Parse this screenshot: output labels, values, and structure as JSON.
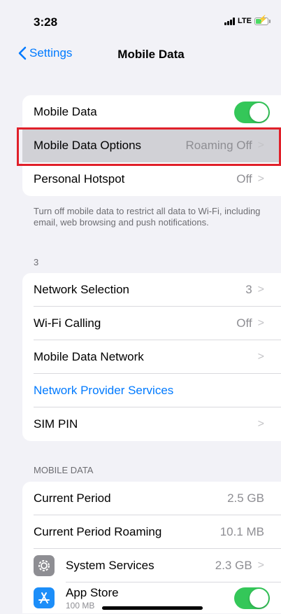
{
  "status_bar": {
    "time": "3:28",
    "network": "LTE"
  },
  "nav": {
    "back_label": "Settings",
    "title": "Mobile Data"
  },
  "group1": {
    "mobile_data": {
      "label": "Mobile Data",
      "toggle_on": true
    },
    "mobile_data_options": {
      "label": "Mobile Data Options",
      "value": "Roaming Off"
    },
    "personal_hotspot": {
      "label": "Personal Hotspot",
      "value": "Off"
    }
  },
  "group1_footer": "Turn off mobile data to restrict all data to Wi-Fi, including email, web browsing and push notifications.",
  "carrier_header": "3",
  "group2": {
    "network_selection": {
      "label": "Network Selection",
      "value": "3"
    },
    "wifi_calling": {
      "label": "Wi-Fi Calling",
      "value": "Off"
    },
    "mobile_data_network": {
      "label": "Mobile Data Network"
    },
    "network_provider_services": {
      "label": "Network Provider Services"
    },
    "sim_pin": {
      "label": "SIM PIN"
    }
  },
  "mobile_data_header": "MOBILE DATA",
  "group3": {
    "current_period": {
      "label": "Current Period",
      "value": "2.5 GB"
    },
    "current_period_roaming": {
      "label": "Current Period Roaming",
      "value": "10.1 MB"
    },
    "system_services": {
      "label": "System Services",
      "value": "2.3 GB",
      "icon": "gear-icon"
    },
    "app_store": {
      "label": "App Store",
      "sub": "100 MB",
      "icon": "app-store-icon",
      "toggle_on": true
    }
  },
  "colors": {
    "accent": "#007aff",
    "toggle_on": "#34c759",
    "highlight_box": "#e0202a"
  }
}
